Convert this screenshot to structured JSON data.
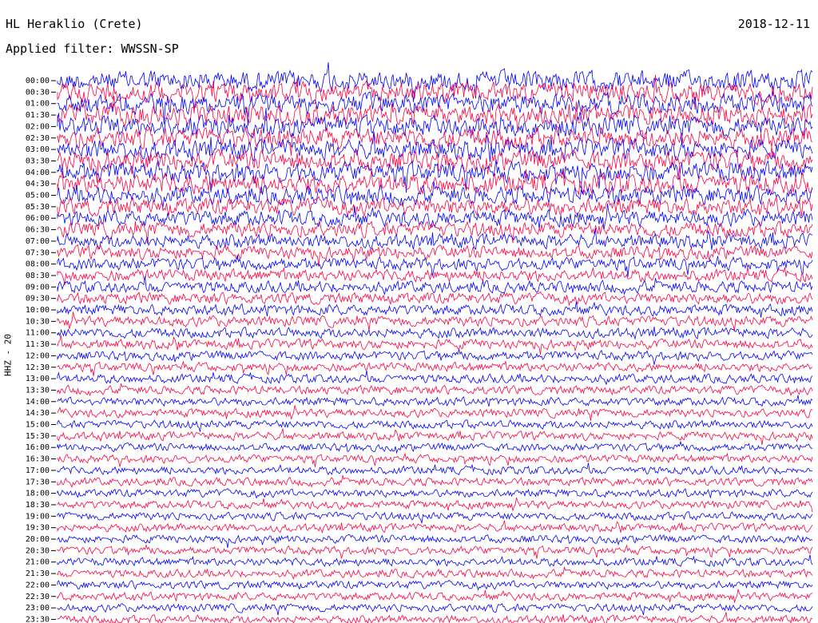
{
  "header": {
    "station": "HL Heraklio (Crete)",
    "date": "2018-12-11",
    "filter": "Applied filter: WWSSN-SP"
  },
  "chart_data": {
    "type": "line",
    "title": "HL Heraklio (Crete)",
    "date": "2018-12-11",
    "filter": "Applied filter: WWSSN-SP",
    "ylabel": "HHZ - 20",
    "rows_per_hour": 2,
    "row_minutes": 30,
    "tick_labels": [
      "00:00",
      "00:30",
      "01:00",
      "01:30",
      "02:00",
      "02:30",
      "03:00",
      "03:30",
      "04:00",
      "04:30",
      "05:00",
      "05:30",
      "06:00",
      "06:30",
      "07:00",
      "07:30",
      "08:00",
      "08:30",
      "09:00",
      "09:30",
      "10:00",
      "10:30",
      "11:00",
      "11:30",
      "12:00",
      "12:30",
      "13:00",
      "13:30",
      "14:00",
      "14:30",
      "15:00",
      "15:30",
      "16:00",
      "16:30",
      "17:00",
      "17:30",
      "18:00",
      "18:30",
      "19:00",
      "19:30",
      "20:00",
      "20:30",
      "21:00",
      "21:30",
      "22:00",
      "22:30",
      "23:00",
      "23:30"
    ],
    "trace_colors": [
      "#0000ff",
      "#ff0040"
    ],
    "relative_amplitude": [
      1.0,
      1.0,
      1.0,
      1.0,
      1.0,
      1.0,
      1.0,
      1.0,
      1.0,
      1.0,
      0.9,
      0.85,
      0.8,
      0.75,
      0.7,
      0.65,
      0.62,
      0.6,
      0.58,
      0.56,
      0.54,
      0.52,
      0.5,
      0.48,
      0.46,
      0.45,
      0.44,
      0.43,
      0.42,
      0.42,
      0.41,
      0.41,
      0.4,
      0.4,
      0.4,
      0.4,
      0.4,
      0.4,
      0.4,
      0.4,
      0.4,
      0.4,
      0.4,
      0.4,
      0.4,
      0.4,
      0.4,
      0.4
    ]
  }
}
